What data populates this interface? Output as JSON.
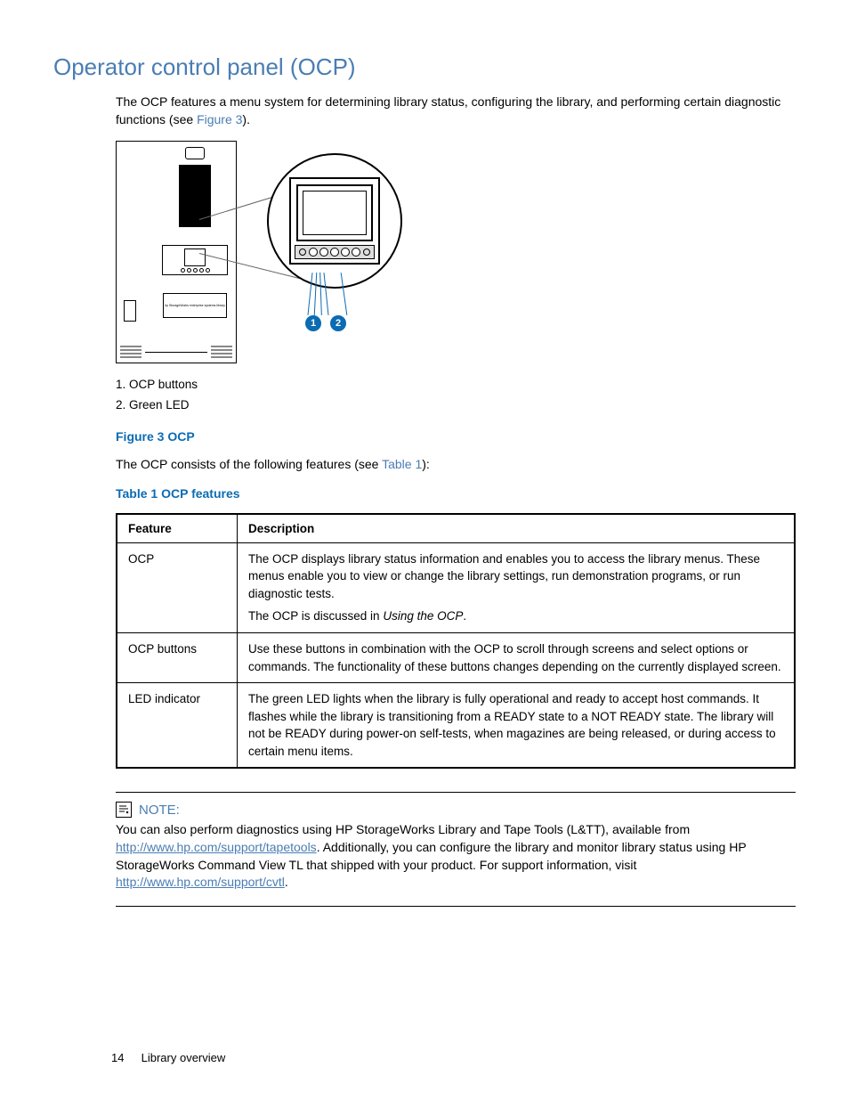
{
  "heading": "Operator control panel (OCP)",
  "intro": {
    "part1": "The OCP features a menu system for determining library status, configuring the library, and performing certain diagnostic functions (see ",
    "figref": "Figure 3",
    "part2": ")."
  },
  "figure": {
    "caption": "Figure 3 OCP",
    "legend": [
      "1. OCP buttons",
      "2. Green LED"
    ],
    "callouts": [
      "1",
      "2"
    ],
    "cabinet_label": "hp StorageWorks enterprise systems library"
  },
  "consists": {
    "part1": "The OCP consists of the following features (see ",
    "tableref": "Table 1",
    "part2": "):"
  },
  "table_caption": "Table 1 OCP features",
  "table": {
    "headers": [
      "Feature",
      "Description"
    ],
    "rows": [
      {
        "feature": "OCP",
        "desc_lines": [
          "The OCP displays library status information and enables you to access the library menus. These menus enable you to view or change the library settings, run demonstration programs, or run diagnostic tests."
        ],
        "desc_line2_prefix": "The OCP is discussed in ",
        "desc_line2_ital": "Using the OCP",
        "desc_line2_suffix": "."
      },
      {
        "feature": "OCP buttons",
        "desc_lines": [
          "Use these buttons in combination with the OCP to scroll through screens and select options or commands. The functionality of these buttons changes depending on the currently displayed screen."
        ]
      },
      {
        "feature": "LED indicator",
        "desc_lines": [
          "The green LED lights when the library is fully operational and ready to accept host commands. It flashes while the library is transitioning from a READY state to a NOT READY state. The library will not be READY during power-on self-tests, when magazines are being released, or during access to certain menu items."
        ]
      }
    ]
  },
  "note": {
    "label": "NOTE:",
    "t1": "You can also perform diagnostics using HP StorageWorks Library and Tape Tools (L&TT), available from ",
    "url1": "http://www.hp.com/support/tapetools",
    "t2": ". Additionally, you can configure the library and monitor library status using HP StorageWorks Command View TL that shipped with your product. For support information, visit ",
    "url2": "http://www.hp.com/support/cvtl",
    "t3": "."
  },
  "footer": {
    "page": "14",
    "section": "Library overview"
  }
}
